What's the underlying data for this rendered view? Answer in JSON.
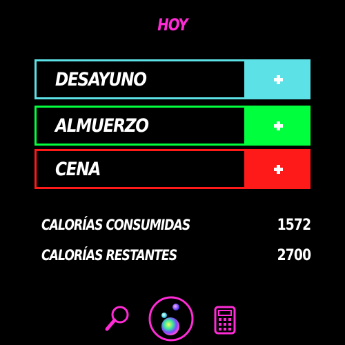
{
  "header": {
    "title": "HOY",
    "title_color": "#ff2bd6"
  },
  "meals": [
    {
      "label": "DESAYUNO",
      "color": "#5be1e6",
      "add_icon": "plus-icon"
    },
    {
      "label": "ALMUERZO",
      "color": "#00ff3c",
      "add_icon": "plus-icon"
    },
    {
      "label": "CENA",
      "color": "#ff1a1a",
      "add_icon": "plus-icon"
    }
  ],
  "stats": {
    "consumed_label": "CALORÍAS CONSUMIDAS",
    "consumed_value": "1572",
    "remaining_label": "CALORÍAS RESTANTES",
    "remaining_value": "2700"
  },
  "nav": {
    "accent_color": "#ff2bd6",
    "items": [
      {
        "icon": "search-icon"
      },
      {
        "icon": "home-icon",
        "active": true
      },
      {
        "icon": "calculator-icon"
      }
    ]
  }
}
